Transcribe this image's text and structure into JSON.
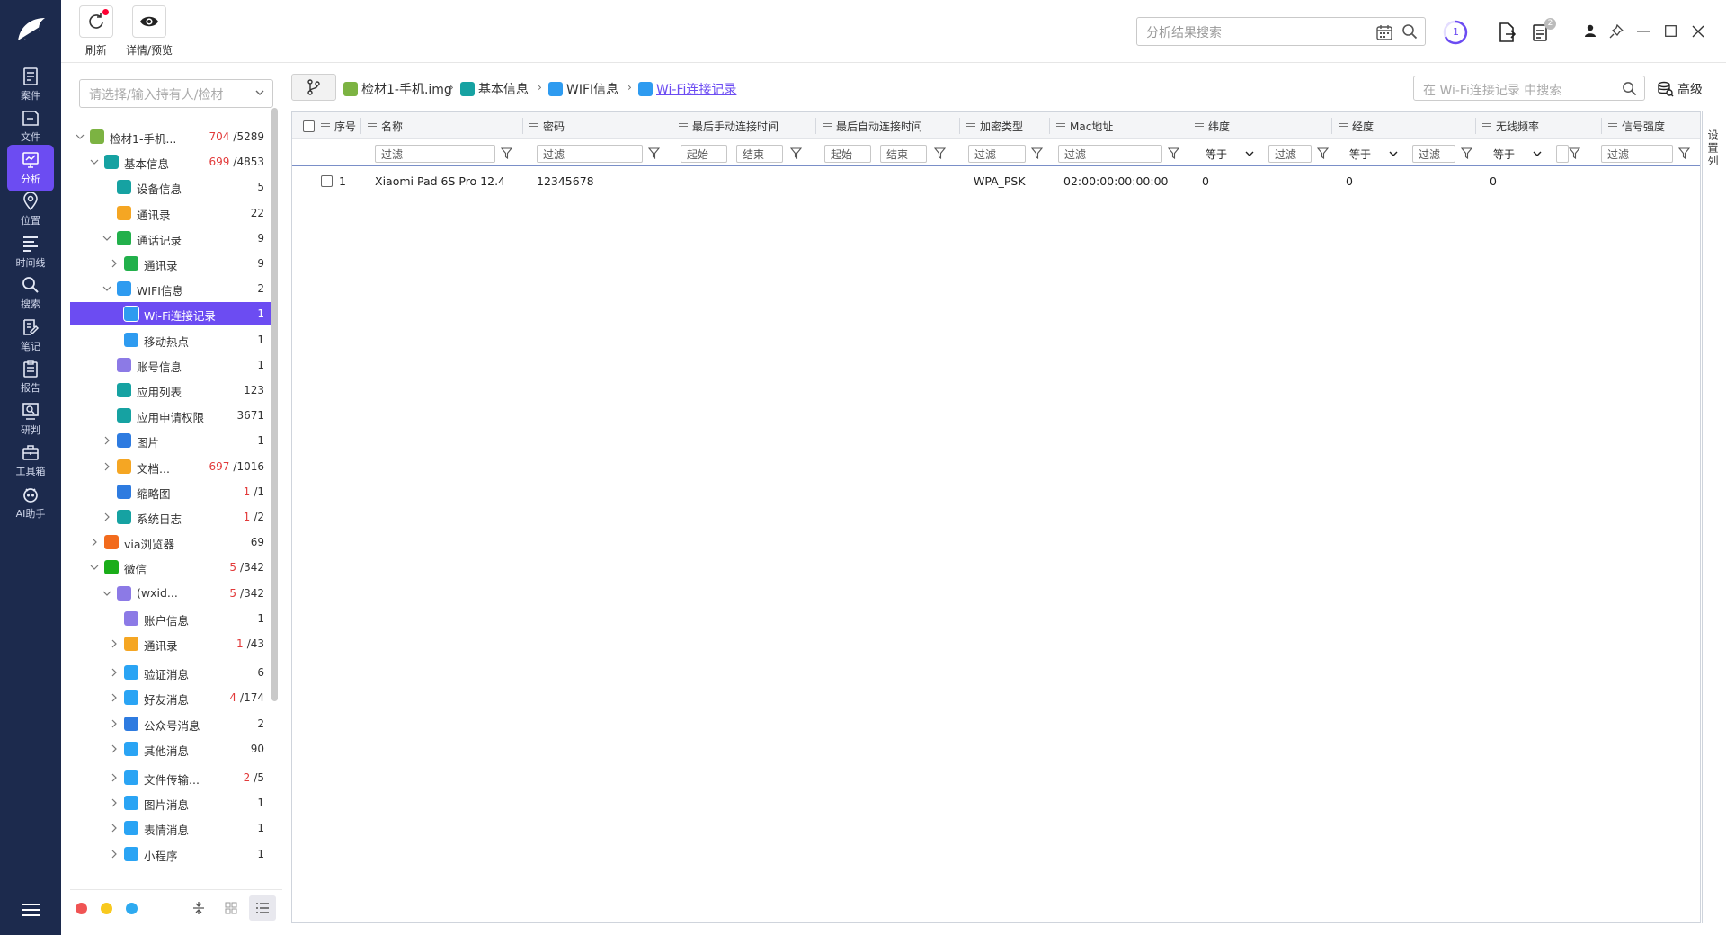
{
  "nav": {
    "items": [
      {
        "label": "案件",
        "icon": "case-icon"
      },
      {
        "label": "文件",
        "icon": "folder-icon"
      },
      {
        "label": "分析",
        "icon": "analysis-icon",
        "active": true
      },
      {
        "label": "位置",
        "icon": "location-icon"
      },
      {
        "label": "时间线",
        "icon": "timeline-icon"
      },
      {
        "label": "搜索",
        "icon": "search-icon"
      },
      {
        "label": "笔记",
        "icon": "note-icon"
      },
      {
        "label": "报告",
        "icon": "report-icon"
      },
      {
        "label": "研判",
        "icon": "judge-icon"
      },
      {
        "label": "工具箱",
        "icon": "toolbox-icon"
      },
      {
        "label": "AI助手",
        "icon": "ai-assistant-icon"
      }
    ]
  },
  "toolbar": {
    "refresh_label": "刷新",
    "detail_label": "详情/预览",
    "search_placeholder": "分析结果搜索",
    "task_count": "1",
    "badge_count": "2"
  },
  "tree": {
    "select_placeholder": "请选择/输入持有人/检材",
    "rows": [
      {
        "label": "检材1-手机...",
        "count_red": "704",
        "count": "/5289",
        "level": 0,
        "arrow": "down",
        "icon": "android-icon",
        "color": "#7cb342"
      },
      {
        "label": "基本信息",
        "count_red": "699",
        "count": "/4853",
        "level": 1,
        "arrow": "down",
        "icon": "basic-info-icon",
        "color": "#16a2a2"
      },
      {
        "label": "设备信息",
        "count_red": "",
        "count": "5",
        "level": 2,
        "arrow": "",
        "icon": "device-icon",
        "color": "#16a2a2"
      },
      {
        "label": "通讯录",
        "count_red": "",
        "count": "22",
        "level": 2,
        "arrow": "",
        "icon": "contacts-icon",
        "color": "#f5a623"
      },
      {
        "label": "通话记录",
        "count_red": "",
        "count": "9",
        "level": 2,
        "arrow": "down",
        "icon": "phone-icon",
        "color": "#22b04b"
      },
      {
        "label": "通讯录",
        "count_red": "",
        "count": "9",
        "level": 3,
        "arrow": "right",
        "icon": "phone-icon",
        "color": "#22b04b"
      },
      {
        "label": "WIFI信息",
        "count_red": "",
        "count": "2",
        "level": 2,
        "arrow": "down",
        "icon": "wifi-icon",
        "color": "#2e9bf0"
      },
      {
        "label": "Wi-Fi连接记录",
        "count_red": "",
        "count": "1",
        "level": 3,
        "arrow": "",
        "icon": "wifi-icon",
        "color": "#2e9bf0",
        "selected": true
      },
      {
        "label": "移动热点",
        "count_red": "",
        "count": "1",
        "level": 3,
        "arrow": "",
        "icon": "wifi-icon",
        "color": "#2e9bf0"
      },
      {
        "label": "账号信息",
        "count_red": "",
        "count": "1",
        "level": 2,
        "arrow": "",
        "icon": "account-icon",
        "color": "#8c7ae6"
      },
      {
        "label": "应用列表",
        "count_red": "",
        "count": "123",
        "level": 2,
        "arrow": "",
        "icon": "app-list-icon",
        "color": "#16a2a2"
      },
      {
        "label": "应用申请权限",
        "count_red": "",
        "count": "3671",
        "level": 2,
        "arrow": "",
        "icon": "permission-icon",
        "color": "#16a2a2"
      },
      {
        "label": "图片",
        "count_red": "",
        "count": "1",
        "level": 2,
        "arrow": "right",
        "icon": "image-icon",
        "color": "#2e7be0"
      },
      {
        "label": "文档...",
        "count_red": "697",
        "count": "/1016",
        "level": 2,
        "arrow": "right",
        "icon": "document-icon",
        "color": "#f5a623"
      },
      {
        "label": "缩略图",
        "count_red": "1",
        "count": "/1",
        "level": 2,
        "arrow": "",
        "icon": "thumbnail-icon",
        "color": "#2e7be0"
      },
      {
        "label": "系统日志",
        "count_red": "1",
        "count": "/2",
        "level": 2,
        "arrow": "right",
        "icon": "log-icon",
        "color": "#16a2a2"
      },
      {
        "label": "via浏览器",
        "count_red": "",
        "count": "69",
        "level": 1,
        "arrow": "right",
        "icon": "via-browser-icon",
        "color": "#f26b1d"
      },
      {
        "label": "微信",
        "count_red": "5",
        "count": "/342",
        "level": 1,
        "arrow": "down",
        "icon": "wechat-icon",
        "color": "#1aad19"
      },
      {
        "label": "(wxid...",
        "count_red": "5",
        "count": "/342",
        "level": 2,
        "arrow": "down",
        "icon": "wechat-user-icon",
        "color": "#8c7ae6"
      },
      {
        "label": "账户信息",
        "count_red": "",
        "count": "1",
        "level": 3,
        "arrow": "",
        "icon": "account-icon",
        "color": "#8c7ae6"
      },
      {
        "label": "通讯录",
        "count_red": "1",
        "count": "/43",
        "level": 3,
        "arrow": "right",
        "icon": "contacts-icon",
        "color": "#f5a623"
      },
      {
        "label": "验证消息",
        "count_red": "",
        "count": "6",
        "level": 3,
        "arrow": "right",
        "icon": "message-icon",
        "color": "#2aa4f4"
      },
      {
        "label": "好友消息",
        "count_red": "4",
        "count": "/174",
        "level": 3,
        "arrow": "right",
        "icon": "message-icon",
        "color": "#2aa4f4"
      },
      {
        "label": "公众号消息",
        "count_red": "",
        "count": "2",
        "level": 3,
        "arrow": "right",
        "icon": "official-account-icon",
        "color": "#2e7be0"
      },
      {
        "label": "其他消息",
        "count_red": "",
        "count": "90",
        "level": 3,
        "arrow": "right",
        "icon": "message-icon",
        "color": "#2aa4f4"
      },
      {
        "label": "文件传输...",
        "count_red": "2",
        "count": "/5",
        "level": 3,
        "arrow": "right",
        "icon": "message-icon",
        "color": "#2aa4f4"
      },
      {
        "label": "图片消息",
        "count_red": "",
        "count": "1",
        "level": 3,
        "arrow": "right",
        "icon": "message-icon",
        "color": "#2aa4f4"
      },
      {
        "label": "表情消息",
        "count_red": "",
        "count": "1",
        "level": 3,
        "arrow": "right",
        "icon": "message-icon",
        "color": "#2aa4f4"
      },
      {
        "label": "小程序",
        "count_red": "",
        "count": "1",
        "level": 3,
        "arrow": "right",
        "icon": "mini-program-icon",
        "color": "#2aa4f4"
      }
    ]
  },
  "breadcrumb": {
    "items": [
      {
        "label": "检材1-手机.img",
        "icon": "android-icon",
        "color": "#7cb342"
      },
      {
        "label": "基本信息",
        "icon": "basic-info-icon",
        "color": "#16a2a2"
      },
      {
        "label": "WIFI信息",
        "icon": "wifi-icon",
        "color": "#2e9bf0"
      },
      {
        "label": "Wi-Fi连接记录",
        "icon": "wifi-icon",
        "color": "#2e9bf0",
        "current": true
      }
    ],
    "search_placeholder": "在 Wi-Fi连接记录 中搜索",
    "advanced_label": "高级"
  },
  "table": {
    "columns": [
      "序号",
      "名称",
      "密码",
      "最后手动连接时间",
      "最后自动连接时间",
      "加密类型",
      "Mac地址",
      "纬度",
      "经度",
      "无线频率",
      "信号强度"
    ],
    "filter_placeholder": "过滤",
    "range_start": "起始",
    "range_end": "结束",
    "equals_label": "等于",
    "rows": [
      {
        "index": "1",
        "name": "Xiaomi Pad 6S Pro 12.4",
        "password": "12345678",
        "manual_time": "",
        "auto_time": "",
        "encryption": "WPA_PSK",
        "mac": "02:00:00:00:00:00",
        "lat": "0",
        "lng": "0",
        "freq": "0",
        "signal": ""
      }
    ],
    "settings_label": "设置列"
  },
  "colors": {
    "nav_bg": "#1c2a4d",
    "accent": "#6c4cf2",
    "count_red": "#e23a3a"
  }
}
